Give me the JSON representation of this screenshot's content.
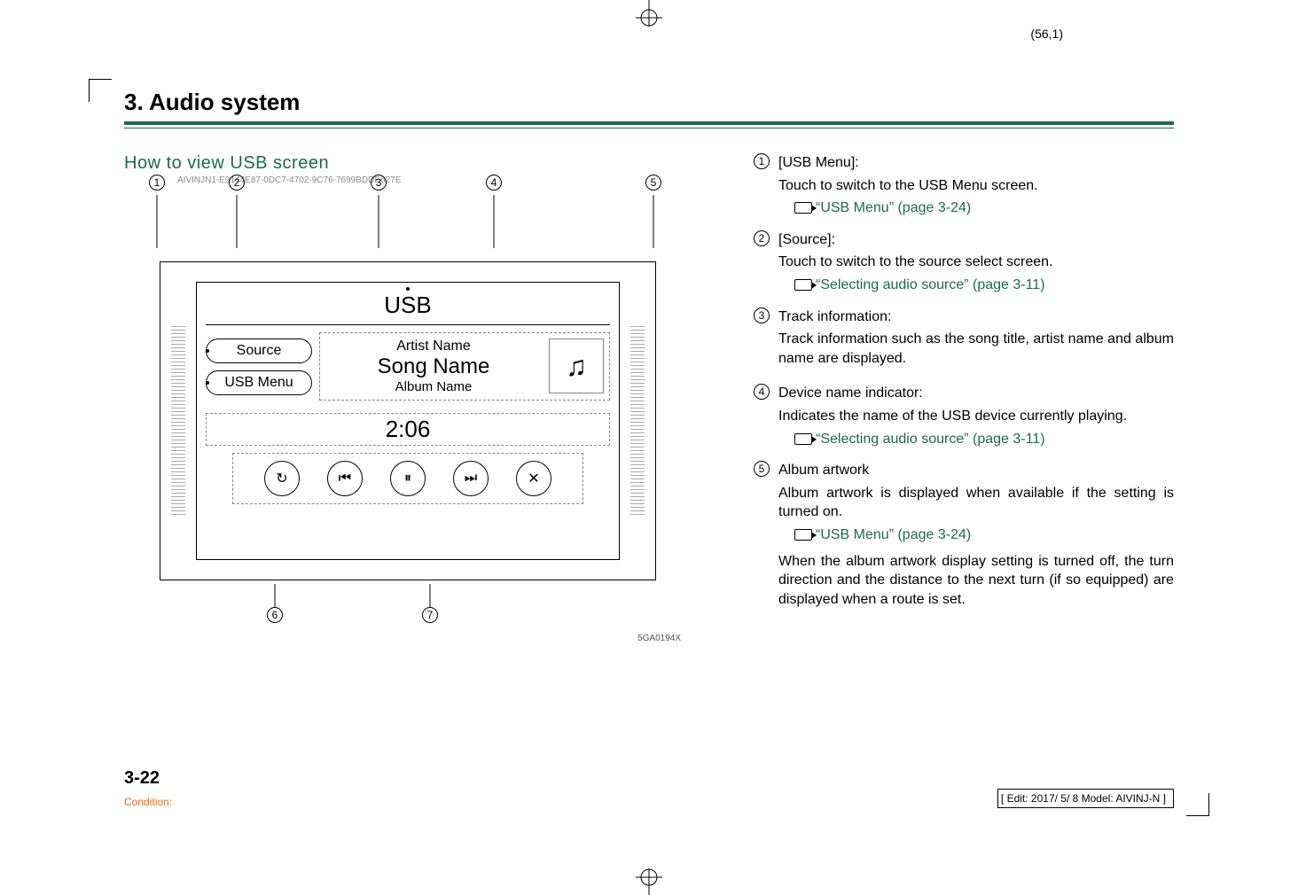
{
  "signature": "(56,1)",
  "section_title": "3. Audio system",
  "subhead": "How to view USB screen",
  "guid": "AIVINJN1-E9144E87-0DC7-4702-9C76-7699BDDE627E",
  "figure_code": "5GA0194X",
  "screen": {
    "title": "USB",
    "source_btn": "Source",
    "menu_btn": "USB Menu",
    "artist": "Artist Name",
    "song": "Song Name",
    "album": "Album Name",
    "time": "2:06",
    "art_glyph": "♫",
    "ctrl_repeat": "↻",
    "ctrl_prev": "⏮",
    "ctrl_pause": "⏸",
    "ctrl_next": "⏭",
    "ctrl_shuffle": "✕"
  },
  "callouts": {
    "c1": "1",
    "c2": "2",
    "c3": "3",
    "c4": "4",
    "c5": "5",
    "c6": "6",
    "c7": "7"
  },
  "items": [
    {
      "num": "1",
      "title": "[USB Menu]:",
      "desc": "Touch to switch to the USB Menu screen.",
      "refs": [
        "“USB Menu” (page 3-24)"
      ]
    },
    {
      "num": "2",
      "title": "[Source]:",
      "desc": "Touch to switch to the source select screen.",
      "refs": [
        "“Selecting audio source” (page 3-11)"
      ]
    },
    {
      "num": "3",
      "title": "Track information:",
      "desc": "Track information such as the song title, artist name and album name are displayed.",
      "refs": []
    },
    {
      "num": "4",
      "title": "Device name indicator:",
      "desc": "Indicates the name of the USB device currently playing.",
      "refs": [
        "“Selecting audio source” (page 3-11)"
      ]
    },
    {
      "num": "5",
      "title": "Album artwork",
      "desc": "Album artwork is displayed when available if the setting is turned on.",
      "refs": [
        "“USB Menu” (page 3-24)"
      ],
      "desc2": "When the album artwork display setting is turned off, the turn direction and the distance to the next turn (if so equipped) are displayed when a route is set."
    }
  ],
  "page_num": "3-22",
  "condition": "Condition:",
  "editbox": "[ Edit: 2017/ 5/ 8   Model: AIVINJ-N ]"
}
